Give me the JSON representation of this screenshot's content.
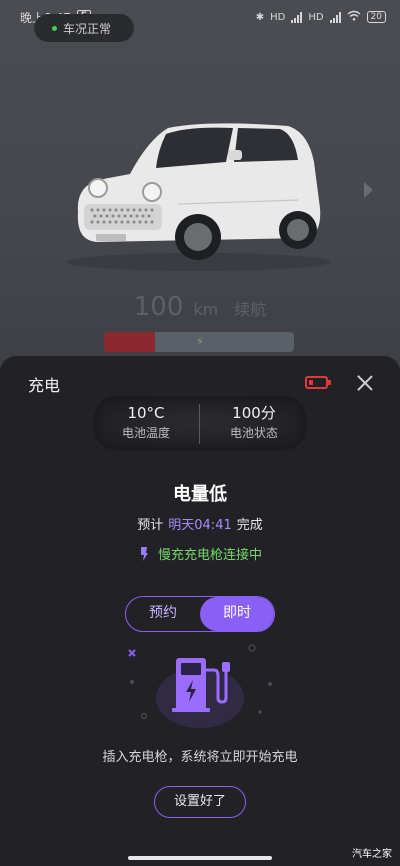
{
  "status_bar": {
    "time": "晚上8:47",
    "app_icon_letter": "E",
    "signal_1": "HD",
    "signal_2": "HD",
    "battery": "20"
  },
  "header": {
    "car_status": "车况正常"
  },
  "car": {
    "plate_text": "ORA"
  },
  "range": {
    "value": "100",
    "unit": "km",
    "label": "续航",
    "battery_level_fraction": 0.27
  },
  "sheet": {
    "title": "充电",
    "battery_temp_value": "10°C",
    "battery_temp_label": "电池温度",
    "battery_state_value": "100分",
    "battery_state_label": "电池状态",
    "status_heading": "电量低",
    "eta_prefix": "预计",
    "eta_time": "明天04:41",
    "eta_suffix": "完成",
    "connection_status": "慢充充电枪连接中",
    "toggle": {
      "reserve_label": "预约",
      "instant_label": "即时",
      "selected": "即时"
    },
    "hint": "插入充电枪，系统将立即开始充电",
    "done_button": "设置好了"
  },
  "colors": {
    "accent_purple": "#8a5ff5",
    "eta_purple": "#a98bff",
    "connect_green": "#74d86a",
    "low_battery_red": "#e03a3a"
  },
  "watermark": "汽车之家"
}
